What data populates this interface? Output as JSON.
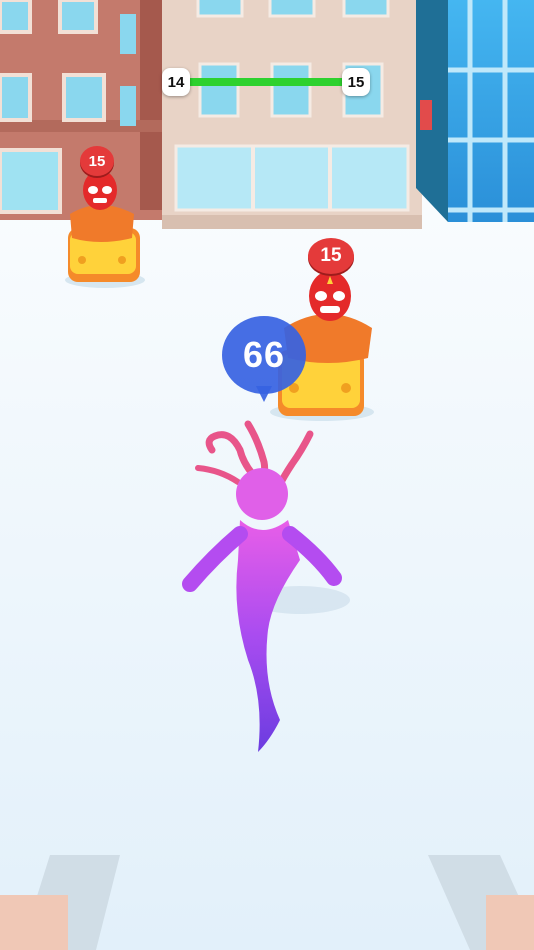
{
  "hud": {
    "level_current": "14",
    "level_next": "15",
    "progress": 1.0
  },
  "enemies": [
    {
      "power": "15"
    },
    {
      "power": "15"
    }
  ],
  "player": {
    "power": "66"
  },
  "colors": {
    "progress_fill": "#2ed12e",
    "enemy_badge": "#e43a3a",
    "player_bubble": "#3662e2",
    "player_body": "#b44cf0",
    "enemy_body": "#f07a2a",
    "enemy_mask": "#e42a2a",
    "car_yellow": "#ffd23a",
    "brick_building": "#c47a6c",
    "beige_building": "#e8d3c6",
    "glass_building": "#3aa9e8"
  }
}
